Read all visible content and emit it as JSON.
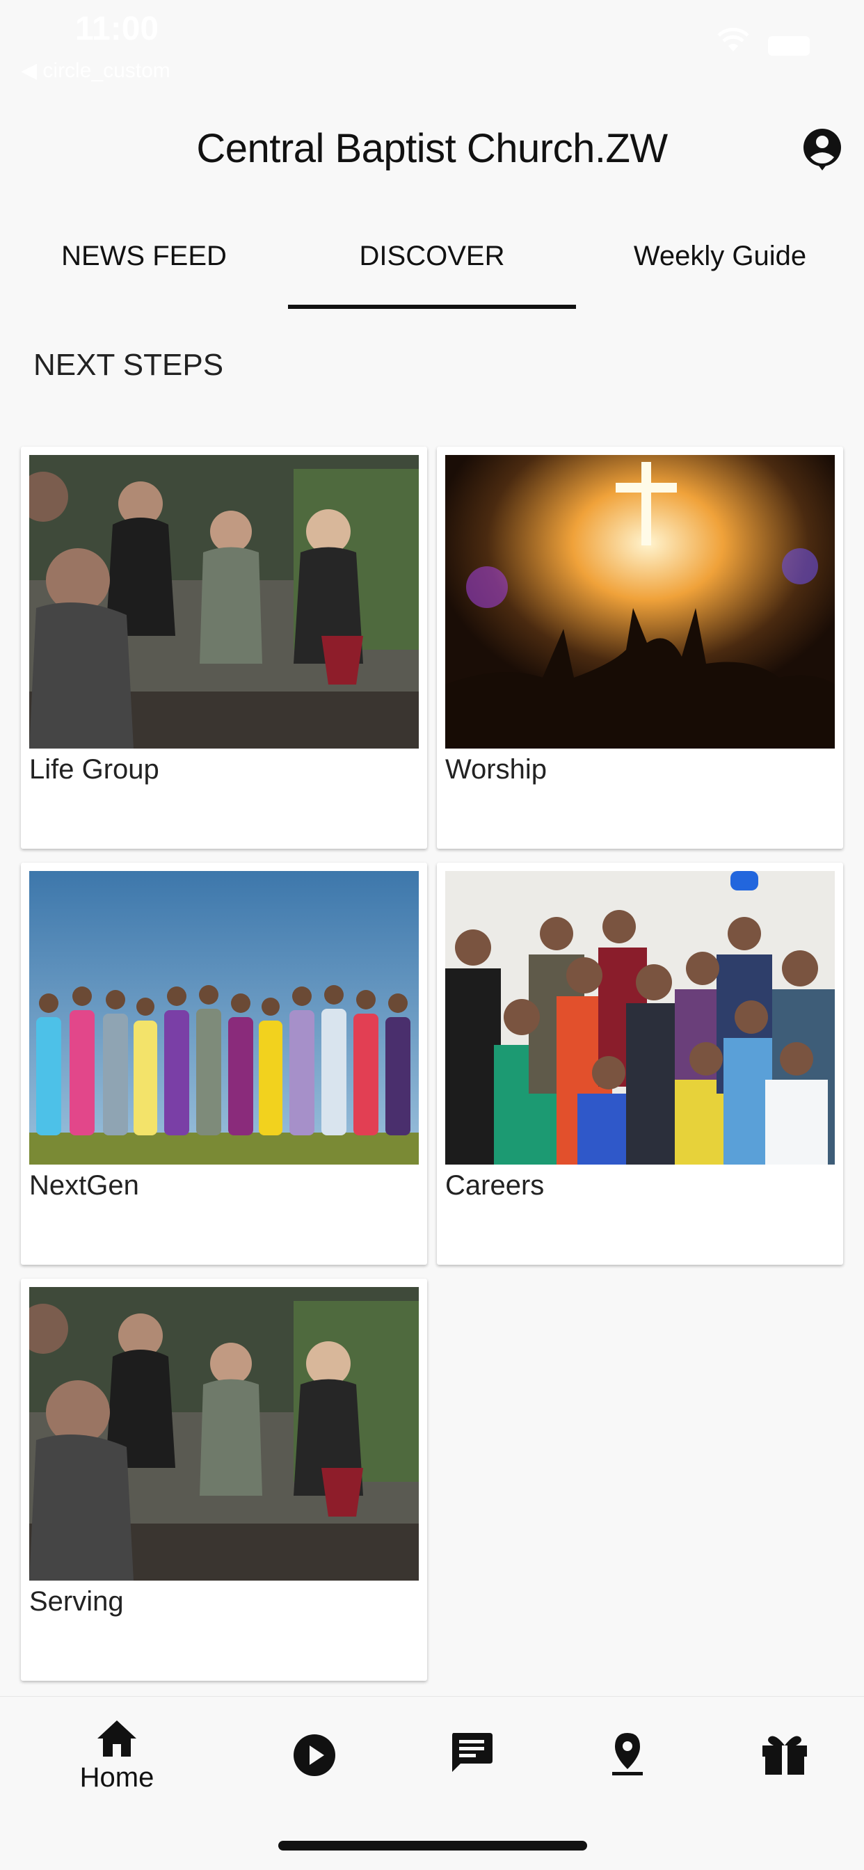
{
  "status_bar": {
    "time": "11:00",
    "back_app": "◀ circle_custom"
  },
  "header": {
    "title": "Central Baptist Church.ZW"
  },
  "tabs": [
    {
      "label": "NEWS FEED",
      "active": false
    },
    {
      "label": "DISCOVER",
      "active": true
    },
    {
      "label": "Weekly Guide",
      "active": false
    }
  ],
  "section": {
    "title": "NEXT STEPS"
  },
  "cards": [
    {
      "label": "Life Group",
      "image": "people-laughing-photo"
    },
    {
      "label": "Worship",
      "image": "worship-cross-photo"
    },
    {
      "label": "NextGen",
      "image": "young-people-row-photo"
    },
    {
      "label": "Careers",
      "image": "professionals-group-photo"
    },
    {
      "label": "Serving",
      "image": "people-laughing-photo"
    }
  ],
  "bottom_nav": {
    "items": [
      {
        "label": "Home",
        "icon": "home-icon",
        "active": true
      },
      {
        "label": "",
        "icon": "play-icon"
      },
      {
        "label": "",
        "icon": "message-icon"
      },
      {
        "label": "",
        "icon": "location-icon"
      },
      {
        "label": "",
        "icon": "gift-icon"
      }
    ]
  },
  "colors": {
    "accent": "#111111",
    "background": "#f8f8f8",
    "card": "#ffffff"
  }
}
